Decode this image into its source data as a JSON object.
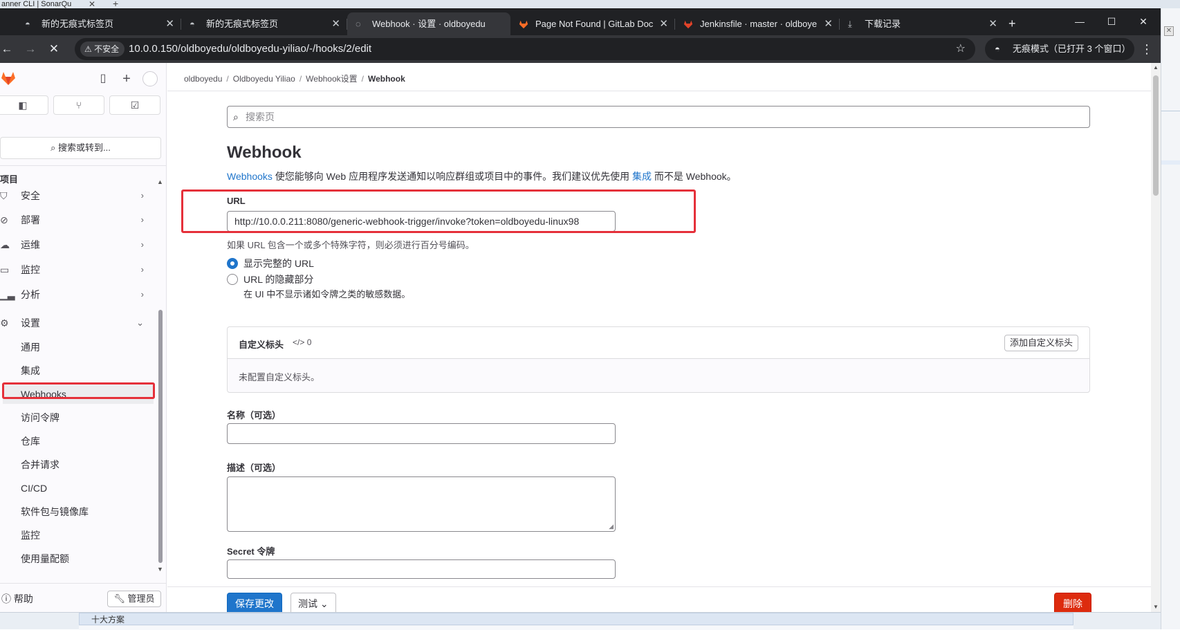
{
  "background": {
    "tab_title": "anner CLI | SonarQu",
    "bottom_text": "十大方案"
  },
  "browser": {
    "tabs": [
      {
        "title": "新的无痕式标签页",
        "icon": "incognito-icon"
      },
      {
        "title": "新的无痕式标签页",
        "icon": "incognito-icon"
      },
      {
        "title": "Webhook · 设置 · oldboyedu",
        "icon": "loading-icon",
        "active": true
      },
      {
        "title": "Page Not Found | GitLab Doc",
        "icon": "gitlab-docs-icon"
      },
      {
        "title": "Jenkinsfile · master · oldboye",
        "icon": "gitlab-icon"
      },
      {
        "title": "下载记录",
        "icon": "download-icon"
      }
    ],
    "security_label": "不安全",
    "url": "10.0.0.150/oldboyedu/oldboyedu-yiliao/-/hooks/2/edit",
    "incognito_label": "无痕模式（已打开 3 个窗口）"
  },
  "sidebar": {
    "search_label": "搜索或转到...",
    "section_heading": "项目",
    "items": [
      {
        "label": "安全",
        "icon": "shield-icon"
      },
      {
        "label": "部署",
        "icon": "rocket-icon"
      },
      {
        "label": "运维",
        "icon": "cloud-gear-icon"
      },
      {
        "label": "监控",
        "icon": "monitor-icon"
      },
      {
        "label": "分析",
        "icon": "chart-icon"
      },
      {
        "label": "设置",
        "icon": "settings-icon"
      }
    ],
    "settings_sub": [
      "通用",
      "集成",
      "Webhooks",
      "访问令牌",
      "仓库",
      "合并请求",
      "CI/CD",
      "软件包与镜像库",
      "监控",
      "使用量配额"
    ],
    "help_label": "帮助",
    "admin_label": "管理员"
  },
  "breadcrumbs": [
    "oldboyedu",
    "Oldboyedu Yiliao",
    "Webhook设置",
    "Webhook"
  ],
  "main": {
    "search_placeholder": "搜索页",
    "title": "Webhook",
    "desc_link1": "Webhooks",
    "desc_text1": " 使您能够向 Web 应用程序发送通知以响应群组或项目中的事件。我们建议优先使用 ",
    "desc_link2": "集成",
    "desc_text2": " 而不是 Webhook。",
    "url_label": "URL",
    "url_value": "http://10.0.0.211:8080/generic-webhook-trigger/invoke?token=oldboyedu-linux98",
    "url_help": "如果 URL 包含一个或多个特殊字符，则必须进行百分号编码。",
    "radio_full": "显示完整的 URL",
    "radio_mask": "URL 的隐藏部分",
    "radio_mask_help": "在 UI 中不显示诸如令牌之类的敏感数据。",
    "custom_headers_title": "自定义标头",
    "custom_headers_count": "0",
    "add_custom_header": "添加自定义标头",
    "no_custom_headers": "未配置自定义标头。",
    "name_label": "名称（可选）",
    "desc_label": "描述（可选）",
    "secret_label": "Secret 令牌",
    "save_button": "保存更改",
    "test_button": "测试",
    "delete_button": "删除"
  }
}
